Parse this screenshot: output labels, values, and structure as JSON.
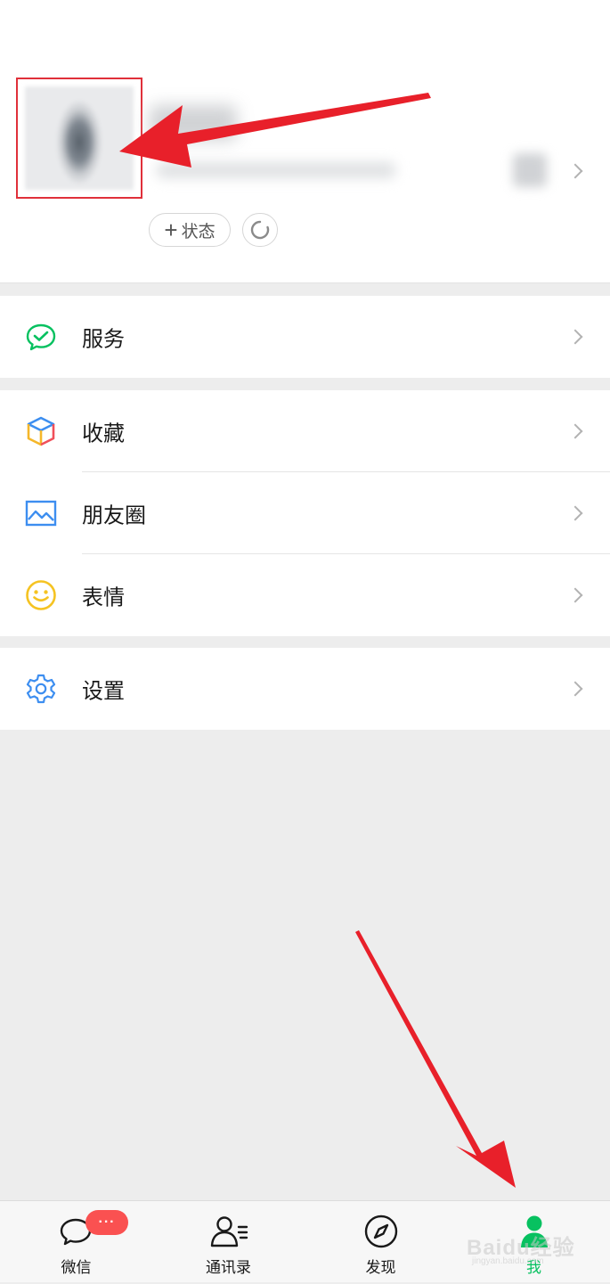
{
  "profile": {
    "status_button_label": "状态",
    "status_plus": "+"
  },
  "menu": {
    "services": "服务",
    "favorites": "收藏",
    "moments": "朋友圈",
    "stickers": "表情",
    "settings": "设置"
  },
  "tabbar": {
    "chats_label": "微信",
    "chats_badge": "···",
    "contacts_label": "通讯录",
    "discover_label": "发现",
    "me_label": "我"
  },
  "watermark": {
    "text": "Baidu经验",
    "sub": "jingyan.baidu.com"
  },
  "colors": {
    "accent_green": "#07c160",
    "badge_red": "#fa5151",
    "annotation_red": "#e8202a",
    "background": "#ededed"
  }
}
